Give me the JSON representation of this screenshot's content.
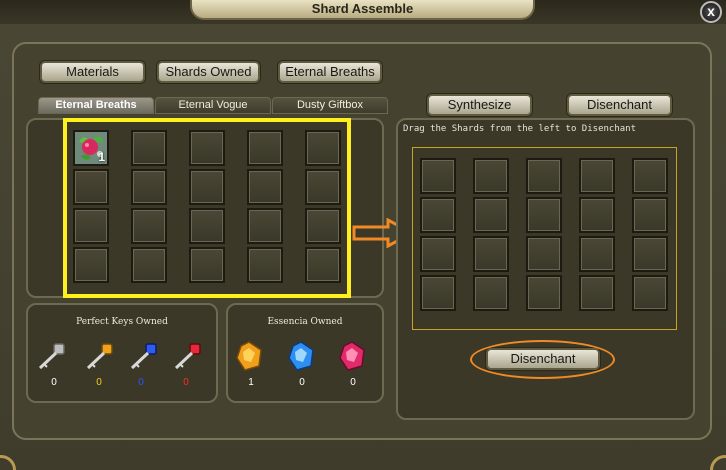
{
  "window": {
    "title": "Shard Assemble",
    "close_label": "x"
  },
  "top_tabs": [
    "Materials",
    "Shards Owned",
    "Eternal Breaths"
  ],
  "sub_tabs": [
    {
      "label": "Eternal Breaths",
      "active": true
    },
    {
      "label": "Eternal Vogue",
      "active": false
    },
    {
      "label": "Dusty Giftbox",
      "active": false
    }
  ],
  "inventory": {
    "first_item": {
      "icon": "berry-plant-icon",
      "count": "1"
    }
  },
  "right_tabs": [
    "Synthesize",
    "Disenchant"
  ],
  "disenchant_panel": {
    "hint": "Drag the Shards from the left to Disenchant",
    "button_label": "Disenchant"
  },
  "keys": {
    "title": "Perfect Keys Owned",
    "items": [
      {
        "icon": "silver-key-icon",
        "count": "0",
        "color": "#ffffff"
      },
      {
        "icon": "gold-key-icon",
        "count": "0",
        "color": "#f2d21b"
      },
      {
        "icon": "blue-key-icon",
        "count": "0",
        "color": "#2d56ff"
      },
      {
        "icon": "red-key-icon",
        "count": "0",
        "color": "#ff2a2a"
      }
    ]
  },
  "essence": {
    "title": "Essencia Owned",
    "items": [
      {
        "icon": "orange-essence-icon",
        "count": "1",
        "color": "#ffffff"
      },
      {
        "icon": "blue-essence-icon",
        "count": "0",
        "color": "#ffffff"
      },
      {
        "icon": "red-essence-icon",
        "count": "0",
        "color": "#ffffff"
      }
    ]
  },
  "colors": {
    "highlight_yellow": "#ffef1c",
    "arrow_orange": "#f08a26"
  }
}
